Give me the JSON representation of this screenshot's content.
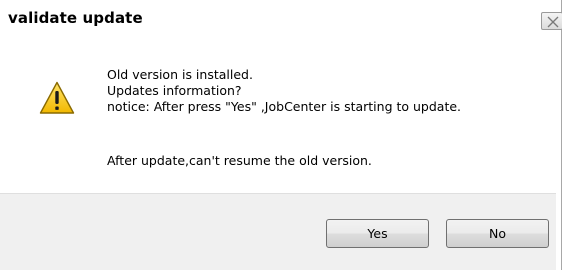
{
  "window": {
    "title": "validate update",
    "close_icon": "close-icon"
  },
  "message": {
    "icon": "warning-icon",
    "line1": "Old version is installed.",
    "line2": "Updates information?",
    "line3": "notice: After press \"Yes\" ,JobCenter is starting to update.",
    "line4": "After update,can't resume the old version."
  },
  "buttons": {
    "yes_label": "Yes",
    "no_label": "No"
  },
  "colors": {
    "warning_yellow": "#f5c400",
    "footer_bg": "#f0f0f0"
  }
}
